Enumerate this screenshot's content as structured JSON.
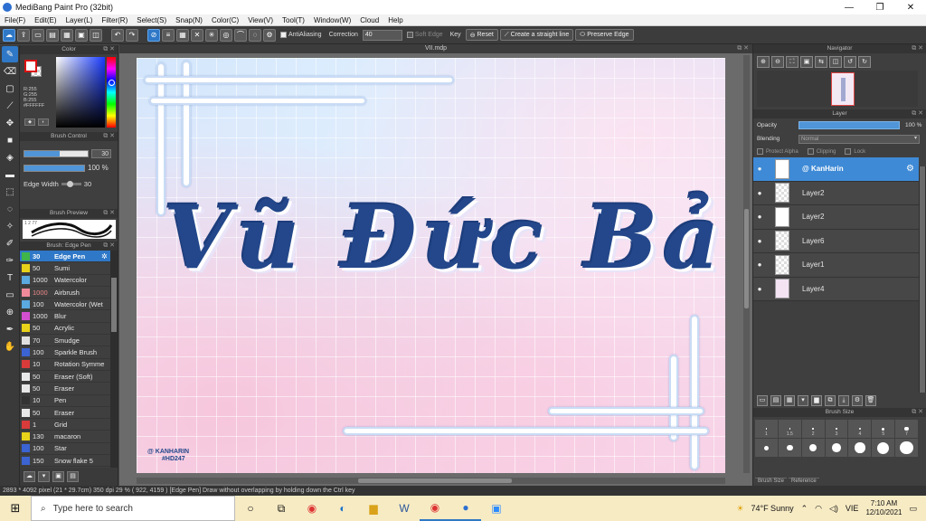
{
  "window": {
    "title": "MediBang Paint Pro (32bit)"
  },
  "menu": [
    "File(F)",
    "Edit(E)",
    "Layer(L)",
    "Filter(R)",
    "Select(S)",
    "Snap(N)",
    "Color(C)",
    "View(V)",
    "Tool(T)",
    "Window(W)",
    "Cloud",
    "Help"
  ],
  "toolbar": {
    "antialiasing_label": "AntiAliasing",
    "correction_label": "Correction",
    "correction_value": "40",
    "soft_edge_label": "Soft Edge",
    "key_label": "Key",
    "reset_label": "Reset",
    "straight_line_label": "Create a straight line",
    "preserve_edge_label": "Preserve Edge"
  },
  "color_panel": {
    "title": "Color",
    "fg_color": "#FFFFFF",
    "rgb_lines": [
      "R:255",
      "G:255",
      "B:255",
      "#FFFFFF"
    ]
  },
  "brush_control": {
    "title": "Brush Control",
    "size_value": "30",
    "size_fill_pct": 55,
    "opacity_label": "100 %",
    "opacity_fill_pct": 100,
    "edge_width_label": "Edge Width",
    "edge_width_value": "30"
  },
  "brush_preview": {
    "title": "Brush Preview",
    "preview_num": "1 2 77"
  },
  "brush_list": {
    "title": "Brush: Edge Pen",
    "items": [
      {
        "size": "30",
        "name": "Edge Pen",
        "color": "#3fb54a",
        "active": true
      },
      {
        "size": "50",
        "name": "Sumi",
        "color": "#e8d21a"
      },
      {
        "size": "1000",
        "name": "Watercolor",
        "color": "#5aa9e0"
      },
      {
        "size": "1000",
        "name": "Airbrush",
        "color": "#f08a9a",
        "red": true
      },
      {
        "size": "100",
        "name": "Watercolor (Wet",
        "color": "#5aa9e0"
      },
      {
        "size": "1000",
        "name": "Blur",
        "color": "#d44fd0"
      },
      {
        "size": "50",
        "name": "Acrylic",
        "color": "#e8d21a"
      },
      {
        "size": "70",
        "name": "Smudge",
        "color": "#e0e0e0"
      },
      {
        "size": "100",
        "name": "Sparkle Brush",
        "color": "#3b63d1"
      },
      {
        "size": "10",
        "name": "Rotation Symme",
        "color": "#d93b3b"
      },
      {
        "size": "50",
        "name": "Eraser (Soft)",
        "color": "#e8e8e8"
      },
      {
        "size": "50",
        "name": "Eraser",
        "color": "#e8e8e8"
      },
      {
        "size": "10",
        "name": "Pen",
        "color": "#333333"
      },
      {
        "size": "50",
        "name": "Eraser",
        "color": "#e8e8e8"
      },
      {
        "size": "1",
        "name": "Grid",
        "color": "#d93b3b"
      },
      {
        "size": "130",
        "name": "macaron",
        "color": "#e8d21a"
      },
      {
        "size": "100",
        "name": "Star",
        "color": "#3b63d1"
      },
      {
        "size": "150",
        "name": "Snow flake 5",
        "color": "#3b63d1"
      }
    ]
  },
  "document": {
    "tab_title": "VII.mdp"
  },
  "artwork": {
    "title_text": "Vũ Đức Bảo",
    "signature_line1": "@ KANHARIN",
    "signature_line2": "#HD247"
  },
  "navigator": {
    "title": "Navigator"
  },
  "layer_panel": {
    "title": "Layer",
    "opacity_label": "Opacity",
    "opacity_value": "100 %",
    "blending_label": "Blending",
    "blending_value": "Normal",
    "protect_alpha_label": "Protect Alpha",
    "clipping_label": "Clipping",
    "lock_label": "Lock",
    "layers": [
      {
        "name": "@ KanHarin",
        "active": true,
        "thumb": "text"
      },
      {
        "name": "Layer2",
        "thumb": "checker"
      },
      {
        "name": "Layer2",
        "thumb": "text"
      },
      {
        "name": "Layer6",
        "thumb": "checker"
      },
      {
        "name": "Layer1",
        "thumb": "checker"
      },
      {
        "name": "Layer4",
        "thumb": "tint"
      }
    ]
  },
  "brush_size": {
    "title": "Brush Size",
    "labels": [
      "1",
      "1.5",
      "2",
      "3",
      "4",
      "5",
      "7"
    ],
    "tabs": [
      "Brush Size",
      "Reference"
    ]
  },
  "status": {
    "text": "2893 * 4092 pixel  (21 * 29.7cm)  350 dpi  29 %  ( 922, 4159 )  [Edge Pen] Draw without overlapping by holding down the Ctrl key"
  },
  "taskbar": {
    "search_placeholder": "Type here to search",
    "weather": "74°F  Sunny",
    "lang": "VIE",
    "time": "7:10 AM",
    "date": "12/10/2021"
  }
}
